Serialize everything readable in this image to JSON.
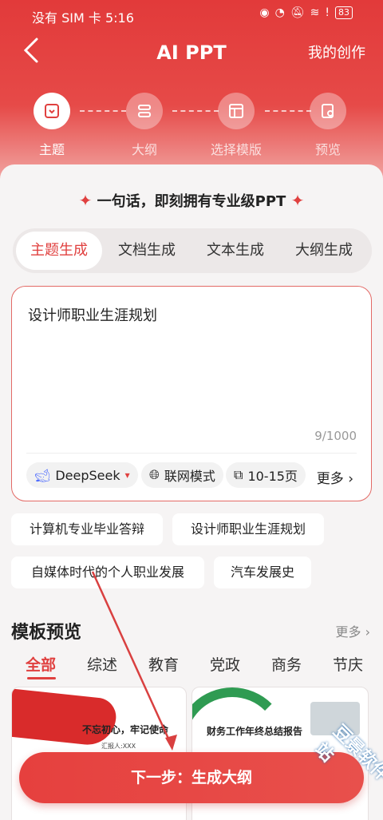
{
  "status": {
    "carrier": "没有 SIM 卡",
    "time": "5:16",
    "battery": "83"
  },
  "nav": {
    "title": "AI PPT",
    "mine": "我的创作"
  },
  "steps": [
    {
      "label": "主题",
      "active": true
    },
    {
      "label": "大纲",
      "active": false
    },
    {
      "label": "选择模版",
      "active": false
    },
    {
      "label": "预览",
      "active": false
    }
  ],
  "slogan": "一句话，即刻拥有专业级PPT",
  "tabs": [
    {
      "label": "主题生成",
      "active": true
    },
    {
      "label": "文档生成",
      "active": false
    },
    {
      "label": "文本生成",
      "active": false
    },
    {
      "label": "大纲生成",
      "active": false
    }
  ],
  "input": {
    "value": "设计师职业生涯规划",
    "count": "9/1000"
  },
  "options": {
    "model": "DeepSeek",
    "network": "联网模式",
    "pages": "10-15页",
    "more": "更多"
  },
  "suggestions": [
    "计算机专业毕业答辩",
    "设计师职业生涯规划",
    "自媒体时代的个人职业发展",
    "汽车发展史"
  ],
  "templates": {
    "title": "模板预览",
    "more": "更多",
    "categories": [
      "全部",
      "综述",
      "教育",
      "党政",
      "商务",
      "节庆"
    ],
    "thumb1_title": "不忘初心，牢记使命",
    "thumb1_sub": "汇报人:XXX",
    "thumb2_title": "财务工作年终总结报告"
  },
  "next_button": "下一步：生成大纲",
  "watermark": "豆景软件站",
  "colors": {
    "accent": "#e0403f",
    "header": "#e23a3a"
  }
}
